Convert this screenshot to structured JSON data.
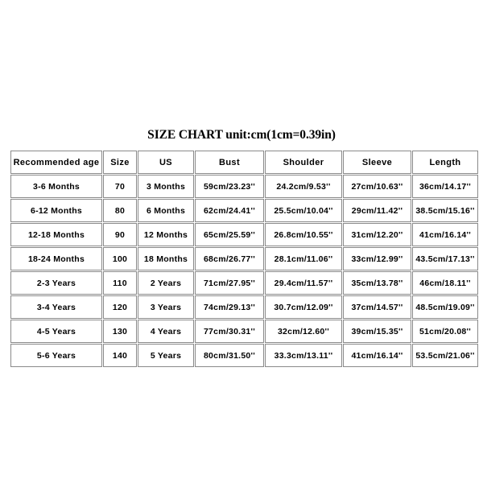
{
  "title": "SIZE CHART unit:cm(1cm=0.39in)",
  "colors": {
    "background": "#ffffff",
    "text": "#000000",
    "border": "#8a8a8a"
  },
  "chart_data": {
    "type": "table",
    "title": "SIZE CHART unit:cm(1cm=0.39in)",
    "columns": [
      "Recommended age",
      "Size",
      "US",
      "Bust",
      "Shoulder",
      "Sleeve",
      "Length"
    ],
    "rows": [
      [
        "3-6 Months",
        "70",
        "3 Months",
        "59cm/23.23''",
        "24.2cm/9.53''",
        "27cm/10.63''",
        "36cm/14.17''"
      ],
      [
        "6-12 Months",
        "80",
        "6 Months",
        "62cm/24.41''",
        "25.5cm/10.04''",
        "29cm/11.42''",
        "38.5cm/15.16''"
      ],
      [
        "12-18 Months",
        "90",
        "12 Months",
        "65cm/25.59''",
        "26.8cm/10.55''",
        "31cm/12.20''",
        "41cm/16.14''"
      ],
      [
        "18-24 Months",
        "100",
        "18 Months",
        "68cm/26.77''",
        "28.1cm/11.06''",
        "33cm/12.99''",
        "43.5cm/17.13''"
      ],
      [
        "2-3 Years",
        "110",
        "2 Years",
        "71cm/27.95''",
        "29.4cm/11.57''",
        "35cm/13.78''",
        "46cm/18.11''"
      ],
      [
        "3-4 Years",
        "120",
        "3 Years",
        "74cm/29.13''",
        "30.7cm/12.09''",
        "37cm/14.57''",
        "48.5cm/19.09''"
      ],
      [
        "4-5 Years",
        "130",
        "4 Years",
        "77cm/30.31''",
        "32cm/12.60''",
        "39cm/15.35''",
        "51cm/20.08''"
      ],
      [
        "5-6 Years",
        "140",
        "5 Years",
        "80cm/31.50''",
        "33.3cm/13.11''",
        "41cm/16.14''",
        "53.5cm/21.06''"
      ]
    ]
  }
}
